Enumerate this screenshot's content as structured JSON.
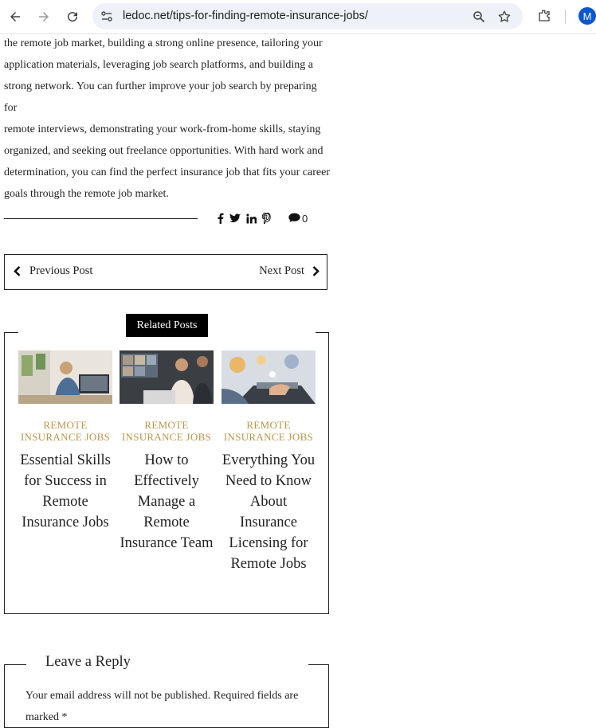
{
  "browser": {
    "url": "ledoc.net/tips-for-finding-remote-insurance-jobs/",
    "avatar_letter": "M",
    "icons": [
      "back-arrow-icon",
      "forward-arrow-icon",
      "reload-icon",
      "site-settings-icon",
      "zoom-icon",
      "star-icon",
      "extensions-icon"
    ]
  },
  "article": {
    "lines": [
      "the remote job market, building a strong online presence, tailoring your",
      "application materials, leveraging job search platforms, and building a",
      "strong network. You can further improve your job search by preparing for",
      "remote interviews, demonstrating your work-from-home skills, staying",
      "organized, and seeking out freelance opportunities. With hard work and",
      "determination, you can find the perfect insurance job that fits your career",
      "goals through the remote job market."
    ]
  },
  "share": {
    "icons": [
      "facebook-icon",
      "twitter-icon",
      "linkedin-icon",
      "pinterest-icon"
    ],
    "comment_count": "0"
  },
  "post_nav": {
    "previous_label": "Previous Post",
    "next_label": "Next Post"
  },
  "related": {
    "heading": "Related Posts",
    "posts": [
      {
        "category": "REMOTE INSURANCE JOBS",
        "title": "Essential Skills for Success in Remote Insurance Jobs"
      },
      {
        "category": "REMOTE INSURANCE JOBS",
        "title": "How to Effectively Manage a Remote Insurance Team"
      },
      {
        "category": "REMOTE INSURANCE JOBS",
        "title": "Everything You Need to Know About Insurance Licensing for Remote Jobs"
      }
    ]
  },
  "reply": {
    "title": "Leave a Reply",
    "note": "Your email address will not be published. Required fields are marked *"
  },
  "colors": {
    "accent": "#b8964c",
    "avatar": "#0b57d0",
    "heading_bg": "#000000"
  }
}
